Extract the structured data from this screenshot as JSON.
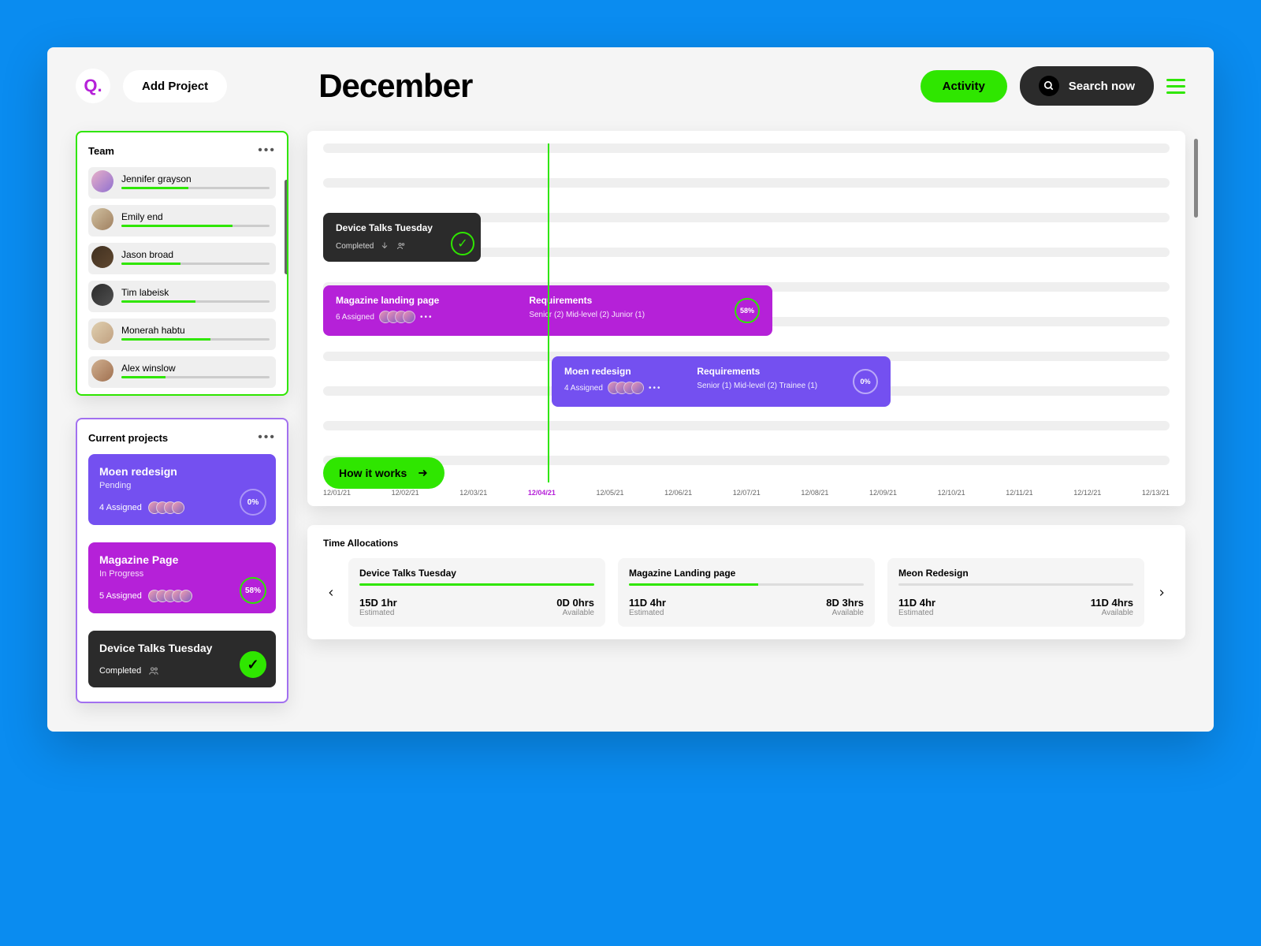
{
  "header": {
    "logo": "Q.",
    "add_project": "Add Project",
    "title": "December",
    "activity": "Activity",
    "search": "Search now"
  },
  "team": {
    "title": "Team",
    "members": [
      {
        "name": "Jennifer grayson",
        "progress": 45
      },
      {
        "name": "Emily end",
        "progress": 75
      },
      {
        "name": "Jason broad",
        "progress": 40
      },
      {
        "name": "Tim labeisk",
        "progress": 50
      },
      {
        "name": "Monerah habtu",
        "progress": 60
      },
      {
        "name": "Alex winslow",
        "progress": 30
      }
    ]
  },
  "projects": {
    "title": "Current projects",
    "items": [
      {
        "name": "Moen redesign",
        "status": "Pending",
        "assigned_text": "4 Assigned",
        "percent": "0%"
      },
      {
        "name": "Magazine Page",
        "status": "In Progress",
        "assigned_text": "5 Assigned",
        "percent": "58%"
      },
      {
        "name": "Device Talks Tuesday",
        "status": "Completed"
      }
    ]
  },
  "timeline": {
    "tasks": {
      "device": {
        "title": "Device Talks Tuesday",
        "status": "Completed"
      },
      "magazine": {
        "title": "Magazine landing page",
        "assigned_text": "6 Assigned",
        "req_title": "Requirements",
        "req_text": "Senior (2) Mid-level (2) Junior (1)",
        "percent": "58%"
      },
      "moen": {
        "title": "Moen redesign",
        "assigned_text": "4 Assigned",
        "req_title": "Requirements",
        "req_text": "Senior (1) Mid-level (2) Trainee (1)",
        "percent": "0%"
      }
    },
    "how_it_works": "How it works",
    "dates": [
      "12/01/21",
      "12/02/21",
      "12/03/21",
      "12/04/21",
      "12/05/21",
      "12/06/21",
      "12/07/21",
      "12/08/21",
      "12/09/21",
      "12/10/21",
      "12/11/21",
      "12/12/21",
      "12/13/21"
    ],
    "highlight_date": "12/04/21"
  },
  "alloc": {
    "title": "Time Allocations",
    "cards": [
      {
        "name": "Device Talks Tuesday",
        "est": "15D 1hr",
        "avail": "0D 0hrs",
        "progress": 100
      },
      {
        "name": "Magazine Landing page",
        "est": "11D 4hr",
        "avail": "8D 3hrs",
        "progress": 55
      },
      {
        "name": "Meon Redesign",
        "est": "11D 4hr",
        "avail": "11D 4hrs",
        "progress": 0
      }
    ],
    "est_lbl": "Estimated",
    "avail_lbl": "Available"
  }
}
